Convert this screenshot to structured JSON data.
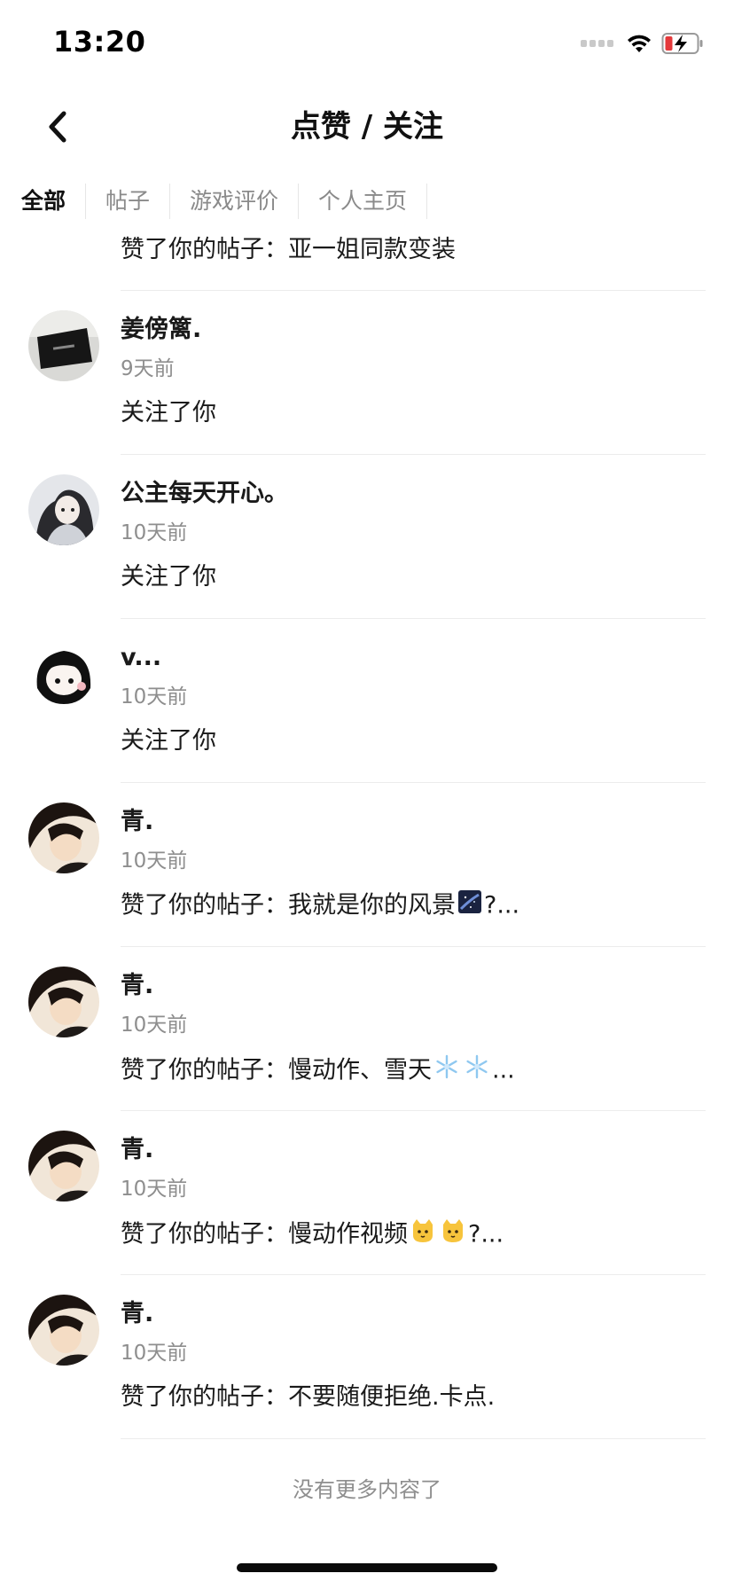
{
  "status_bar": {
    "time": "13:20"
  },
  "header": {
    "title": "点赞 / 关注"
  },
  "tabs": [
    {
      "label": "全部",
      "active": true
    },
    {
      "label": "帖子",
      "active": false
    },
    {
      "label": "游戏评价",
      "active": false
    },
    {
      "label": "个人主页",
      "active": false
    }
  ],
  "partial_item": {
    "action": "赞了你的帖子：亚一姐同款变装"
  },
  "items": [
    {
      "name": "姜傍篱.",
      "time": "9天前",
      "action": "关注了你",
      "avatar": "dark-monitor"
    },
    {
      "name": "公主每天开心。",
      "time": "10天前",
      "action": "关注了你",
      "avatar": "anime-girl-grey"
    },
    {
      "name": "v...",
      "time": "10天前",
      "action": "关注了你",
      "avatar": "anime-boy-black"
    },
    {
      "name": "青.",
      "time": "10天前",
      "action_prefix": "赞了你的帖子：我就是你的风景",
      "action_suffix": "?...",
      "emojis": [
        "galaxy-emoji"
      ],
      "avatar": "portrait"
    },
    {
      "name": "青.",
      "time": "10天前",
      "action_prefix": "赞了你的帖子：慢动作、雪天",
      "action_suffix": "...",
      "emojis": [
        "snowflake-emoji",
        "snowflake-emoji"
      ],
      "avatar": "portrait"
    },
    {
      "name": "青.",
      "time": "10天前",
      "action_prefix": "赞了你的帖子：慢动作视频",
      "action_suffix": "?...",
      "emojis": [
        "cat-emoji",
        "cat-emoji"
      ],
      "avatar": "portrait"
    },
    {
      "name": "青.",
      "time": "10天前",
      "action": "赞了你的帖子：不要随便拒绝.卡点.",
      "avatar": "portrait"
    }
  ],
  "footer": {
    "text": "没有更多内容了"
  },
  "colors": {
    "background": "#ffffff",
    "text_primary": "#1a1a1a",
    "text_secondary": "#8e8e8e",
    "divider": "#ececec",
    "battery_low": "#e5393b"
  }
}
